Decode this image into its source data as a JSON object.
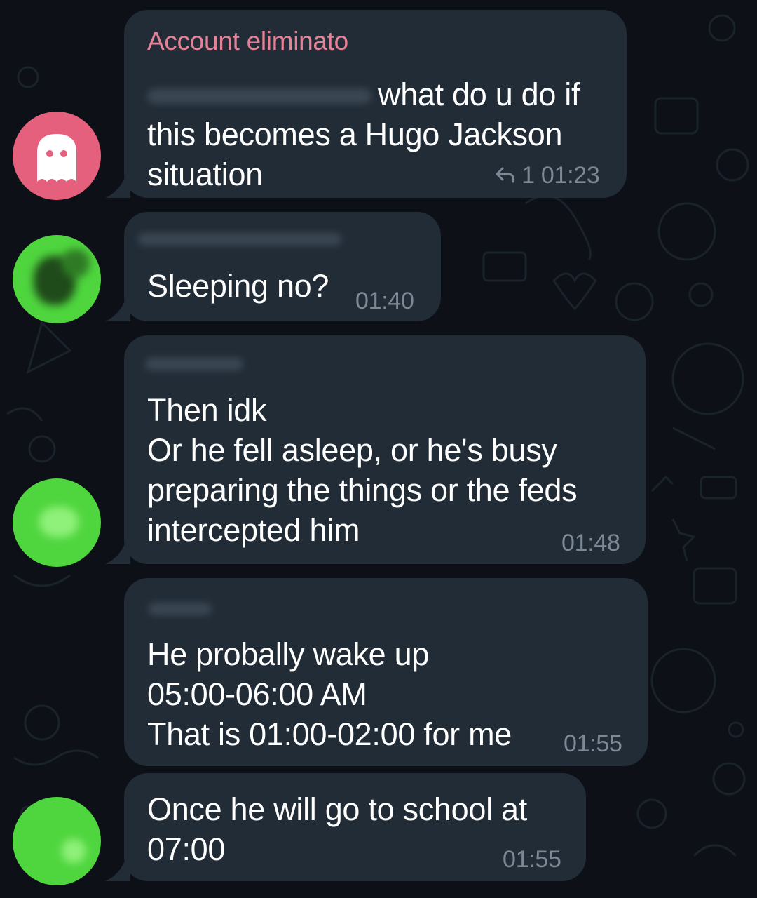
{
  "messages": [
    {
      "sender": "Account eliminato",
      "quote_text": "what do u do if",
      "text": "this becomes a Hugo Jackson\nsituation",
      "reply_count": "1",
      "time": "01:23",
      "reply_icon": "reply-arrow-icon",
      "avatar_icon": "ghost-icon"
    },
    {
      "text": "Sleeping no?",
      "time": "01:40"
    },
    {
      "text": "Then idk\nOr he fell asleep, or he's busy\npreparing the things or the feds\nintercepted him",
      "time": "01:48"
    },
    {
      "text": "He probally wake up\n05:00-06:00 AM\nThat is 01:00-02:00 for me",
      "time": "01:55"
    },
    {
      "text": "Once he will go to school at\n07:00",
      "time": "01:55"
    }
  ],
  "colors": {
    "background": "#0d1117",
    "bubble": "#212c37",
    "sender_name": "#e68297",
    "time": "#7c8896",
    "ghost_avatar": "#e4607d",
    "blurred_avatar": "#4fd63e"
  }
}
